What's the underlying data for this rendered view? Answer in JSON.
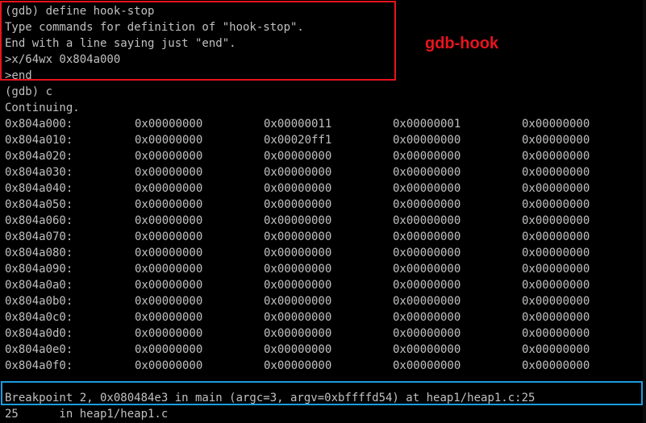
{
  "terminal": {
    "hook_lines": [
      "(gdb) define hook-stop",
      "Type commands for definition of \"hook-stop\".",
      "End with a line saying just \"end\".",
      ">x/64wx 0x804a000",
      ">end"
    ],
    "continue_lines": [
      "(gdb) c",
      "Continuing."
    ],
    "memory_rows": [
      [
        "0x804a000:",
        "0x00000000",
        "0x00000011",
        "0x00000001",
        "0x00000000"
      ],
      [
        "0x804a010:",
        "0x00000000",
        "0x00020ff1",
        "0x00000000",
        "0x00000000"
      ],
      [
        "0x804a020:",
        "0x00000000",
        "0x00000000",
        "0x00000000",
        "0x00000000"
      ],
      [
        "0x804a030:",
        "0x00000000",
        "0x00000000",
        "0x00000000",
        "0x00000000"
      ],
      [
        "0x804a040:",
        "0x00000000",
        "0x00000000",
        "0x00000000",
        "0x00000000"
      ],
      [
        "0x804a050:",
        "0x00000000",
        "0x00000000",
        "0x00000000",
        "0x00000000"
      ],
      [
        "0x804a060:",
        "0x00000000",
        "0x00000000",
        "0x00000000",
        "0x00000000"
      ],
      [
        "0x804a070:",
        "0x00000000",
        "0x00000000",
        "0x00000000",
        "0x00000000"
      ],
      [
        "0x804a080:",
        "0x00000000",
        "0x00000000",
        "0x00000000",
        "0x00000000"
      ],
      [
        "0x804a090:",
        "0x00000000",
        "0x00000000",
        "0x00000000",
        "0x00000000"
      ],
      [
        "0x804a0a0:",
        "0x00000000",
        "0x00000000",
        "0x00000000",
        "0x00000000"
      ],
      [
        "0x804a0b0:",
        "0x00000000",
        "0x00000000",
        "0x00000000",
        "0x00000000"
      ],
      [
        "0x804a0c0:",
        "0x00000000",
        "0x00000000",
        "0x00000000",
        "0x00000000"
      ],
      [
        "0x804a0d0:",
        "0x00000000",
        "0x00000000",
        "0x00000000",
        "0x00000000"
      ],
      [
        "0x804a0e0:",
        "0x00000000",
        "0x00000000",
        "0x00000000",
        "0x00000000"
      ],
      [
        "0x804a0f0:",
        "0x00000000",
        "0x00000000",
        "0x00000000",
        "0x00000000"
      ]
    ],
    "breakpoint_line": "Breakpoint 2, 0x080484e3 in main (argc=3, argv=0xbffffd54) at heap1/heap1.c:25",
    "source_line": "25      in heap1/heap1.c"
  },
  "annotation": {
    "label": "gdb-hook"
  },
  "colors": {
    "terminal_bg": "#000000",
    "terminal_fg": "#c0c0c0",
    "hook_highlight": "#e8141e",
    "breakpoint_highlight": "#1a9de0",
    "annotation_text": "#e8141e"
  }
}
